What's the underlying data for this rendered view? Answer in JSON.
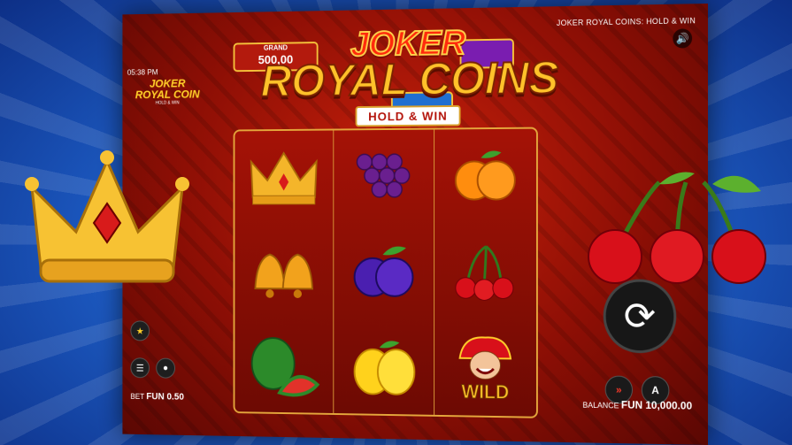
{
  "status_bar": {
    "time": "05:38 PM"
  },
  "header": {
    "game_title": "JOKER ROYAL COINS: HOLD & WIN",
    "sound_icon": "speaker-icon"
  },
  "jackpots": [
    {
      "label": "GRAND",
      "value": "500,00",
      "color": "#b31a0d"
    },
    {
      "label": "",
      "value": "",
      "color": "#7a1db0"
    },
    {
      "label": "",
      "value": "",
      "color": "#1f6fd1"
    }
  ],
  "logo": {
    "small_line1": "JOKER",
    "small_line2": "ROYAL COIN",
    "small_line3": "HOLD & WIN",
    "joker": "JOKER",
    "royal_coins": "ROYAL COINS",
    "hold_win": "HOLD & WIN"
  },
  "reels": [
    [
      "crown",
      "bells",
      "watermelon"
    ],
    [
      "grapes",
      "plum",
      "lemon"
    ],
    [
      "orange",
      "cherries",
      "joker-wild"
    ]
  ],
  "wild_label": "WILD",
  "controls": {
    "favorite_icon": "star-icon",
    "menu_icon": "menu-icon",
    "coin_icon": "coin-stack-icon",
    "spin_icon": "spin-arrows-icon",
    "turbo_icon": "fast-forward-icon",
    "autoplay_icon": "autoplay-icon"
  },
  "bet": {
    "label": "BET",
    "value": "FUN 0.50"
  },
  "balance": {
    "label": "BALANCE",
    "value": "FUN 10,000.00"
  },
  "colors": {
    "accent_gold": "#ffc22a",
    "reel_red": "#a51206",
    "background_blue": "#1e5fc9"
  }
}
